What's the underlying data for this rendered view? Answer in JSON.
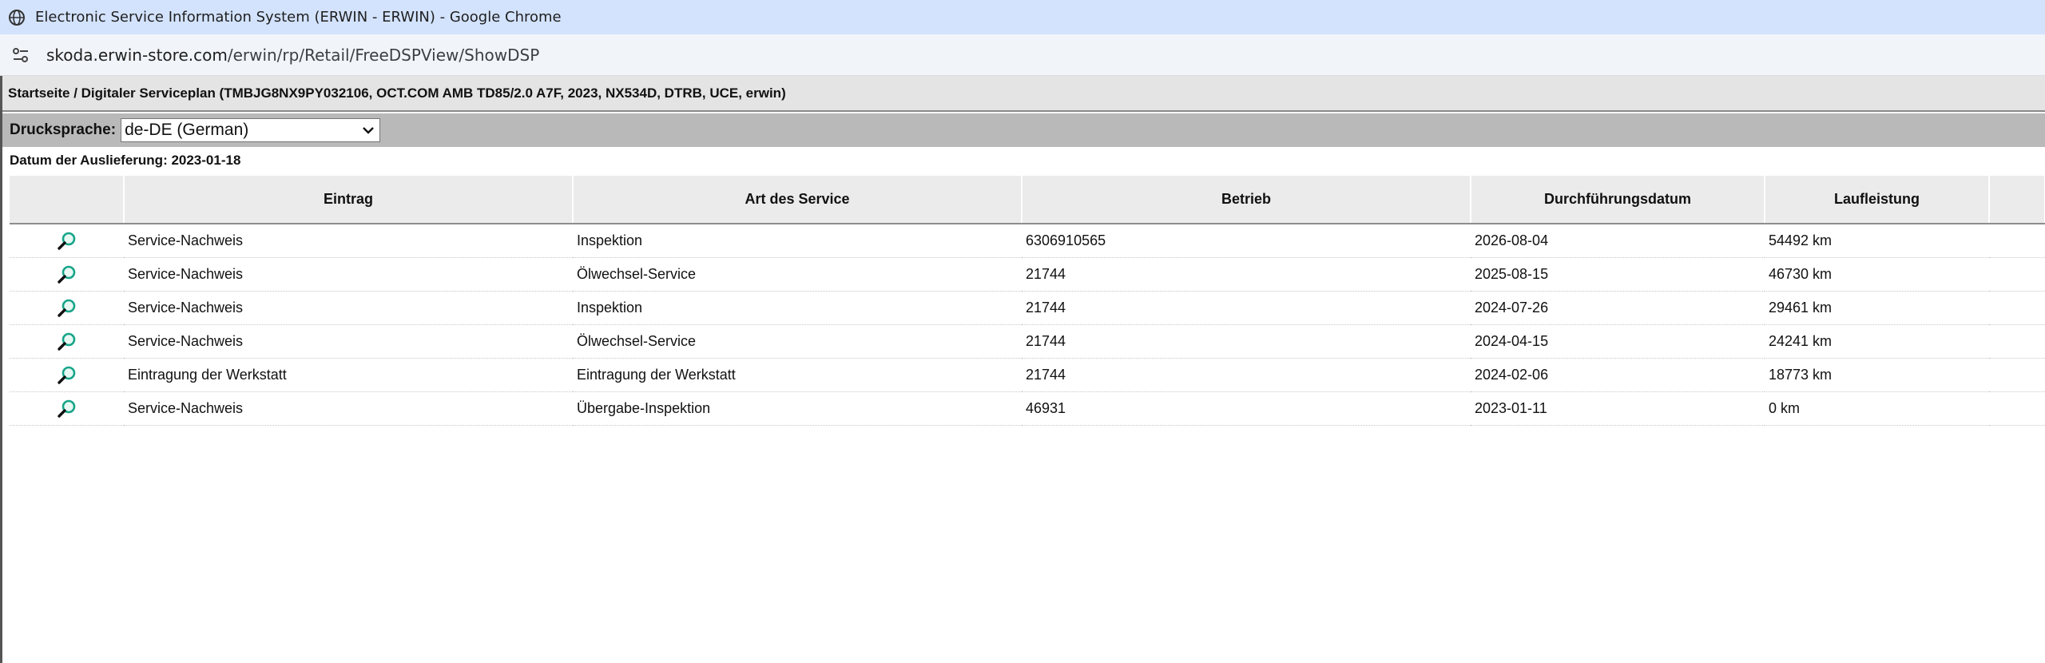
{
  "browser": {
    "window_title": "Electronic Service Information System (ERWIN - ERWIN) - Google Chrome",
    "url_host": "skoda.erwin-store.com",
    "url_path": "/erwin/rp/Retail/FreeDSPView/ShowDSP"
  },
  "breadcrumb": "Startseite / Digitaler Serviceplan (TMBJG8NX9PY032106, OCT.COM AMB TD85/2.0 A7F, 2023, NX534D, DTRB, UCE, erwin)",
  "language": {
    "label": "Drucksprache:",
    "selected": "de-DE (German)"
  },
  "delivery_date": "Datum der Auslieferung: 2023-01-18",
  "table": {
    "columns": [
      "",
      "Eintrag",
      "Art des Service",
      "Betrieb",
      "Durchführungsdatum",
      "Laufleistung",
      ""
    ],
    "rows": [
      {
        "entry": "Service-Nachweis",
        "service": "Inspektion",
        "workshop": "6306910565",
        "date": "2026-08-04",
        "mileage": "54492 km"
      },
      {
        "entry": "Service-Nachweis",
        "service": "Ölwechsel-Service",
        "workshop": "21744",
        "date": "2025-08-15",
        "mileage": "46730 km"
      },
      {
        "entry": "Service-Nachweis",
        "service": "Inspektion",
        "workshop": "21744",
        "date": "2024-07-26",
        "mileage": "29461 km"
      },
      {
        "entry": "Service-Nachweis",
        "service": "Ölwechsel-Service",
        "workshop": "21744",
        "date": "2024-04-15",
        "mileage": "24241 km"
      },
      {
        "entry": "Eintragung der Werkstatt",
        "service": "Eintragung der Werkstatt",
        "workshop": "21744",
        "date": "2024-02-06",
        "mileage": "18773 km"
      },
      {
        "entry": "Service-Nachweis",
        "service": "Übergabe-Inspektion",
        "workshop": "46931",
        "date": "2023-01-11",
        "mileage": "0 km"
      }
    ]
  },
  "colors": {
    "titlebar": "#d3e3fd",
    "header_bar": "#e4e4e4",
    "language_bar": "#b9b9b9",
    "magnifier": "#17a589"
  },
  "icons": {
    "title": "globe-icon",
    "address": "site-settings-icon",
    "row": "magnifier-icon",
    "select": "chevron-down-icon"
  }
}
